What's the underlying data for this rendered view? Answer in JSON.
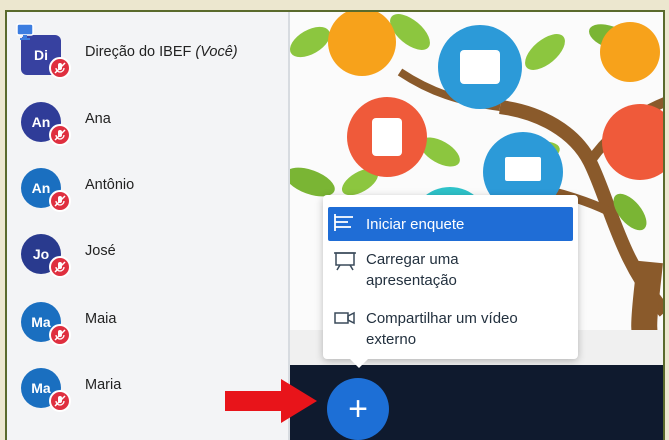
{
  "users": [
    {
      "initials": "Di",
      "name": "Direção do IBEF",
      "you_label": "(Você)",
      "color": "#3741a0",
      "presenter": true
    },
    {
      "initials": "An",
      "name": "Ana",
      "color": "#2f3c98",
      "presenter": false
    },
    {
      "initials": "An",
      "name": "Antônio",
      "color": "#1a6fc0",
      "presenter": false
    },
    {
      "initials": "Jo",
      "name": "José",
      "color": "#293a8e",
      "presenter": false
    },
    {
      "initials": "Ma",
      "name": "Maia",
      "color": "#1a6fc0",
      "presenter": false
    },
    {
      "initials": "Ma",
      "name": "Maria",
      "color": "#1a6fc0",
      "presenter": false
    }
  ],
  "actions_menu": {
    "items": [
      {
        "label": "Iniciar enquete",
        "icon": "poll-icon",
        "active": true
      },
      {
        "label_line1": "Carregar uma",
        "label_line2": "apresentação",
        "icon": "presentation-icon",
        "active": false
      },
      {
        "label_line1": "Compartilhar um vídeo",
        "label_line2": "externo",
        "icon": "video-icon",
        "active": false
      }
    ]
  },
  "actions_button": {
    "label": "+"
  },
  "colors": {
    "accent": "#1d6fd6",
    "muted_red": "#df2f3f",
    "control_bar": "#0f1a2e",
    "annotation_arrow": "#e8141a"
  }
}
